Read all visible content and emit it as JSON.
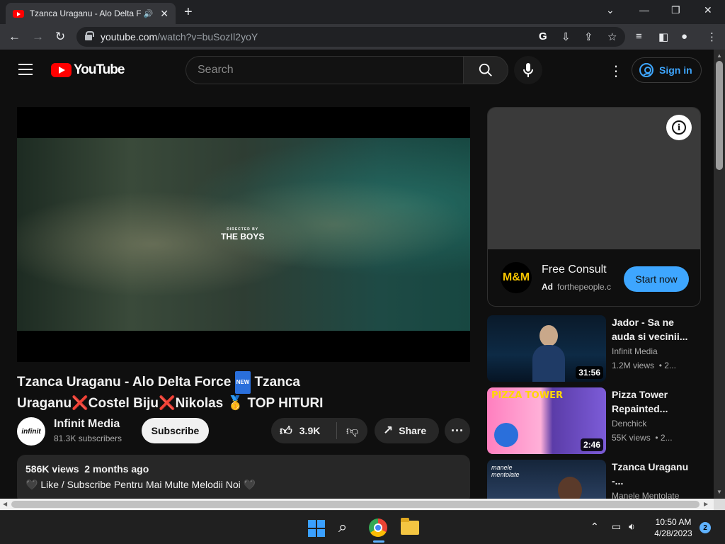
{
  "browser": {
    "tab_title": "Tzanca Uraganu - Alo Delta F",
    "tab_audio_icon": "speaker-icon",
    "url_host": "youtube.com",
    "url_path": "/watch?v=buSozIl2yoY",
    "window_controls": [
      "minimize",
      "maximize",
      "close"
    ]
  },
  "header": {
    "logo_text": "YouTube",
    "search_placeholder": "Search",
    "sign_in": "Sign in"
  },
  "video": {
    "frame_credit_small": "DIRECTED BY",
    "frame_credit": "THE BOYS",
    "title_part1": "Tzanca Uraganu - Alo Delta Force ",
    "new_badge": "NEW",
    "title_part2": " Tzanca Uraganu",
    "x1": "❌",
    "title_part3": "Costel Biju",
    "x2": "❌",
    "title_part4": "Nikolas ",
    "medal": "🥇",
    "title_part5": " TOP HITURI",
    "channel": "Infinit Media",
    "avatar_text": "infinit",
    "subscribers": "81.3K subscribers",
    "subscribe_label": "Subscribe",
    "likes": "3.9K",
    "share_label": "Share",
    "views": "586K views",
    "age": "2 months ago",
    "description_line": "🖤 Like / Subscribe Pentru Mai Multe Melodii Noi 🖤"
  },
  "ad": {
    "logo_text": "M&M",
    "title": "Free Consult",
    "badge": "Ad",
    "domain": "forthepeople.c",
    "cta": "Start now"
  },
  "recommendations": [
    {
      "title": "Jador - Sa ne auda si vecinii...",
      "channel": "Infinit Media",
      "views": "1.2M views",
      "age": "• 2...",
      "duration": "31:56"
    },
    {
      "title": "Pizza Tower Repainted...",
      "channel": "Denchick",
      "views": "55K views",
      "age": "• 2...",
      "duration": "2:46"
    },
    {
      "title": "Tzanca Uraganu -...",
      "channel": "Manele Mentolate",
      "views": "",
      "age": "",
      "duration": ""
    }
  ],
  "taskbar": {
    "time": "10:50 AM",
    "date": "4/28/2023",
    "notifications": "2"
  }
}
